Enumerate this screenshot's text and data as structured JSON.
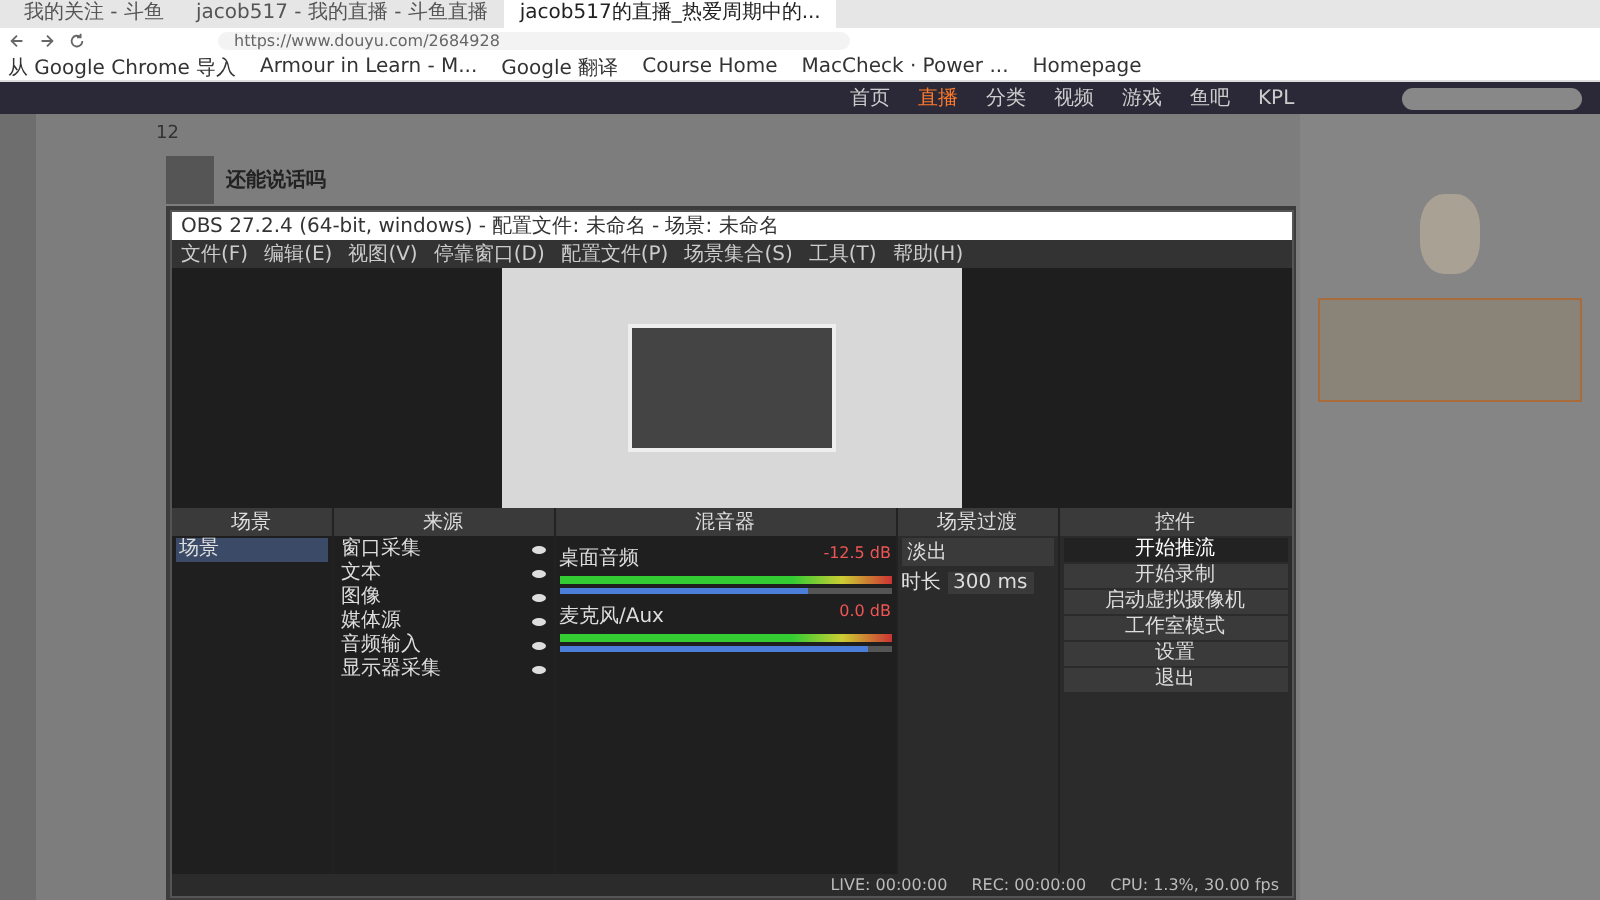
{
  "browser": {
    "tabs": [
      {
        "title": "我的关注 - 斗鱼",
        "selected": false
      },
      {
        "title": "jacob517 - 我的直播 - 斗鱼直播",
        "selected": false
      },
      {
        "title": "jacob517的直播_热爱周期中的...",
        "selected": true
      }
    ],
    "address": "https://www.douyu.com/2684928",
    "bookmarks": [
      "从 Google Chrome 导入",
      "Armour in Learn - M...",
      "Google 翻译",
      "Course Home",
      "MacCheck · Power ...",
      "Homepage"
    ]
  },
  "site": {
    "nav": [
      {
        "label": "首页",
        "selected": false
      },
      {
        "label": "直播",
        "selected": true
      },
      {
        "label": "分类",
        "selected": false
      },
      {
        "label": "视频",
        "selected": false
      },
      {
        "label": "游戏",
        "selected": false
      },
      {
        "label": "鱼吧",
        "selected": false
      },
      {
        "label": "KPL",
        "selected": false
      }
    ],
    "follow_count": "12",
    "streamer": {
      "name": "还能说话吗"
    }
  },
  "obs": {
    "title": "OBS 27.2.4 (64-bit, windows) - 配置文件: 未命名 - 场景: 未命名",
    "menu": [
      "文件(F)",
      "编辑(E)",
      "视图(V)",
      "停靠窗口(D)",
      "配置文件(P)",
      "场景集合(S)",
      "工具(T)",
      "帮助(H)"
    ],
    "docks": [
      "场景",
      "来源",
      "混音器",
      "场景过渡",
      "控件"
    ],
    "scenes": [
      {
        "name": "场景",
        "selected": true
      }
    ],
    "sources": [
      {
        "name": "窗口采集",
        "visible": true
      },
      {
        "name": "文本",
        "visible": true
      },
      {
        "name": "图像",
        "visible": true
      },
      {
        "name": "媒体源",
        "visible": true
      },
      {
        "name": "音频输入",
        "visible": true
      },
      {
        "name": "显示器采集",
        "visible": true
      }
    ],
    "mixer": [
      {
        "name": "桌面音频",
        "reading": "-12.5 dB",
        "level": 0.75
      },
      {
        "name": "麦克风/Aux",
        "reading": "0.0 dB",
        "level": 0.93
      }
    ],
    "transition": {
      "type": "淡出",
      "duration_label": "时长",
      "duration": "300 ms"
    },
    "controls": [
      {
        "label": "开始推流",
        "selected": true
      },
      {
        "label": "开始录制",
        "selected": false
      },
      {
        "label": "启动虚拟摄像机",
        "selected": false
      },
      {
        "label": "工作室模式",
        "selected": false
      },
      {
        "label": "设置",
        "selected": false
      },
      {
        "label": "退出",
        "selected": false
      }
    ],
    "status": [
      "LIVE: 00:00:00",
      "REC: 00:00:00",
      "CPU: 1.3%, 30.00 fps"
    ]
  }
}
